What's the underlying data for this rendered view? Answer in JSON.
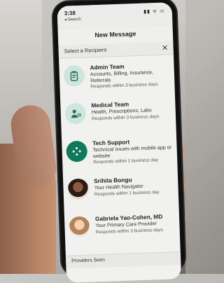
{
  "statusbar": {
    "time": "3:38",
    "back_label": "◂ Search"
  },
  "header": {
    "title": "New Message"
  },
  "subheader": {
    "label": "Select a Recipient",
    "close_icon": "close-icon"
  },
  "recipients": [
    {
      "name": "Admin Team",
      "desc": "Accounts, Billing, Insurance, Referrals",
      "resp": "Responds within 3 business days",
      "icon": "clipboard-icon"
    },
    {
      "name": "Medical Team",
      "desc": "Health, Prescriptions, Labs",
      "resp": "Responds within 3 business days",
      "icon": "doctor-icon"
    },
    {
      "name": "Tech Support",
      "desc": "Technical issues with mobile app or website",
      "resp": "Responds within 1 business day",
      "icon": "settings-dots-icon"
    },
    {
      "name": "Srihita Bongu",
      "desc": "Your Health Navigator",
      "resp": "Responds within 1 business day",
      "icon": "avatar"
    },
    {
      "name": "Gabriela Yao-Cohen, MD",
      "desc": "Your Primary Care Provider",
      "resp": "Responds within 3 business days",
      "icon": "avatar"
    }
  ],
  "footer": {
    "label": "Providers Seen"
  },
  "colors": {
    "accent": "#0e7a5a",
    "soft_accent": "#cfe6df"
  }
}
